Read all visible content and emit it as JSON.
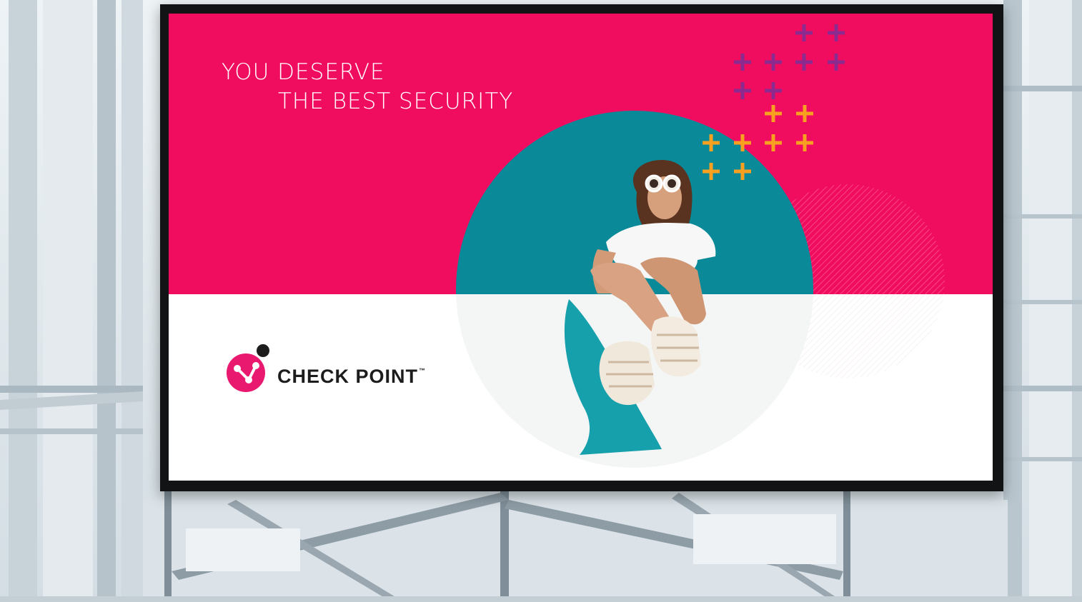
{
  "billboard": {
    "headline_line1": "YOU DESERVE",
    "headline_line2": "THE BEST SECURITY",
    "brand_name": "CHECK POINT",
    "brand_tm": "™"
  },
  "icons": [
    "check-point-logo-icon",
    "plus-icon",
    "sunglasses-woman-photo"
  ],
  "colors": {
    "pink": "#f00c5f",
    "teal": "#0a8a99",
    "purple": "#8b2b8f",
    "orange": "#f8a020",
    "logo_pink": "#e8196f",
    "text_dark": "#1c1c1c"
  }
}
